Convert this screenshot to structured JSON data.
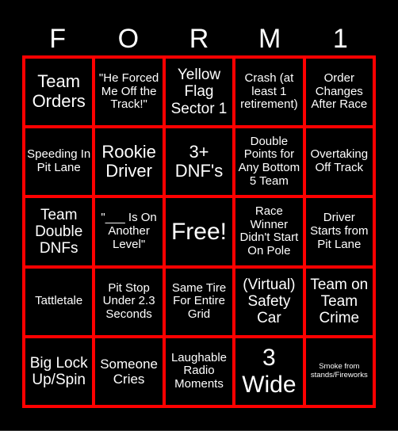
{
  "title_letters": [
    "F",
    "O",
    "R",
    "M",
    "1"
  ],
  "colors": {
    "background": "#000000",
    "grid_lines": "#ff0000",
    "text": "#ffffff"
  },
  "cells": [
    {
      "text": "Team Orders",
      "size": "xl"
    },
    {
      "text": "\"He Forced Me Off the Track!\"",
      "size": "sm"
    },
    {
      "text": "Yellow Flag Sector 1",
      "size": "lg"
    },
    {
      "text": "Crash (at least 1 retirement)",
      "size": "sm"
    },
    {
      "text": "Order Changes After Race",
      "size": "sm"
    },
    {
      "text": "Speeding In Pit Lane",
      "size": "sm"
    },
    {
      "text": "Rookie Driver",
      "size": "xl"
    },
    {
      "text": "3+ DNF's",
      "size": "xl"
    },
    {
      "text": "Double Points for Any Bottom 5 Team",
      "size": "sm"
    },
    {
      "text": "Overtaking Off Track",
      "size": "sm"
    },
    {
      "text": "Team Double DNFs",
      "size": "lg"
    },
    {
      "text": "\"___ Is On Another Level\"",
      "size": "sm"
    },
    {
      "text": "Free!",
      "size": "xxl"
    },
    {
      "text": "Race Winner Didn't Start On Pole",
      "size": "sm"
    },
    {
      "text": "Driver Starts from Pit Lane",
      "size": "sm"
    },
    {
      "text": "Tattletale",
      "size": "sm"
    },
    {
      "text": "Pit Stop Under 2.3 Seconds",
      "size": "sm"
    },
    {
      "text": "Same Tire For Entire Grid",
      "size": "sm"
    },
    {
      "text": "(Virtual) Safety Car",
      "size": "lg"
    },
    {
      "text": "Team on Team Crime",
      "size": "lg"
    },
    {
      "text": "Big Lock Up/Spin",
      "size": "lg"
    },
    {
      "text": "Someone Cries",
      "size": "md"
    },
    {
      "text": "Laughable Radio Moments",
      "size": "sm"
    },
    {
      "text": "3 Wide",
      "size": "xxl"
    },
    {
      "text": "Smoke from stands/Fireworks",
      "size": "xs"
    }
  ]
}
